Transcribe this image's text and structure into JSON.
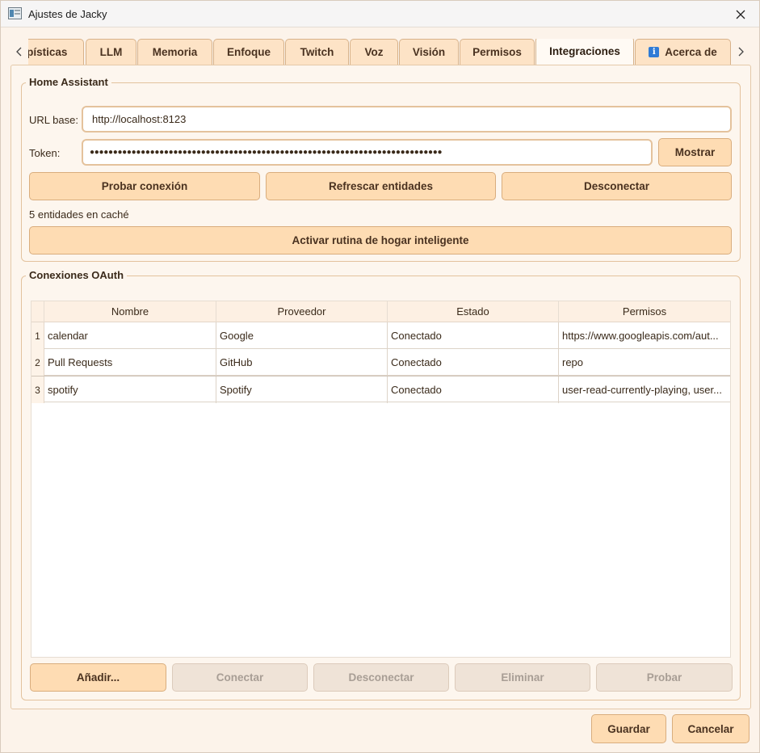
{
  "window": {
    "title": "Ajustes de Jacky"
  },
  "tabs": [
    {
      "label": "ерísticas"
    },
    {
      "label": "LLM"
    },
    {
      "label": "Memoria"
    },
    {
      "label": "Enfoque"
    },
    {
      "label": "Twitch"
    },
    {
      "label": "Voz"
    },
    {
      "label": "Visión"
    },
    {
      "label": "Permisos"
    },
    {
      "label": "Integraciones",
      "active": true
    },
    {
      "label": "Acerca de",
      "icon": "info-icon"
    }
  ],
  "home_assistant": {
    "title": "Home Assistant",
    "url_label": "URL base:",
    "url_value": "http://localhost:8123",
    "token_label": "Token:",
    "token_value": "●●●●●●●●●●●●●●●●●●●●●●●●●●●●●●●●●●●●●●●●●●●●●●●●●●●●●●●●●●●●●●●●●●●●●●●●●●●●",
    "show_button": "Mostrar",
    "test_button": "Probar conexión",
    "refresh_button": "Refrescar entidades",
    "disconnect_button": "Desconectar",
    "cache_status": "5 entidades en caché",
    "routine_button": "Activar rutina de hogar inteligente"
  },
  "oauth": {
    "title": "Conexiones OAuth",
    "columns": [
      "Nombre",
      "Proveedor",
      "Estado",
      "Permisos"
    ],
    "rows": [
      {
        "num": "1",
        "name": "calendar",
        "provider": "Google",
        "status": "Conectado",
        "scopes": "https://www.googleapis.com/aut..."
      },
      {
        "num": "2",
        "name": "Pull Requests",
        "provider": "GitHub",
        "status": "Conectado",
        "scopes": "repo"
      },
      {
        "num": "3",
        "name": "spotify",
        "provider": "Spotify",
        "status": "Conectado",
        "scopes": "user-read-currently-playing, user..."
      }
    ],
    "buttons": {
      "add": "Añadir...",
      "connect": "Conectar",
      "disconnect": "Desconectar",
      "delete": "Eliminar",
      "test": "Probar"
    }
  },
  "footer": {
    "save": "Guardar",
    "cancel": "Cancelar"
  },
  "icons": {
    "app": "settings-window-icon",
    "close": "close-icon",
    "prev": "chevron-left-icon",
    "next": "chevron-right-icon",
    "info": "info-icon"
  },
  "colors": {
    "accent": "#fedcb3",
    "border": "#d9ad7d",
    "background": "#fcf3ea"
  }
}
